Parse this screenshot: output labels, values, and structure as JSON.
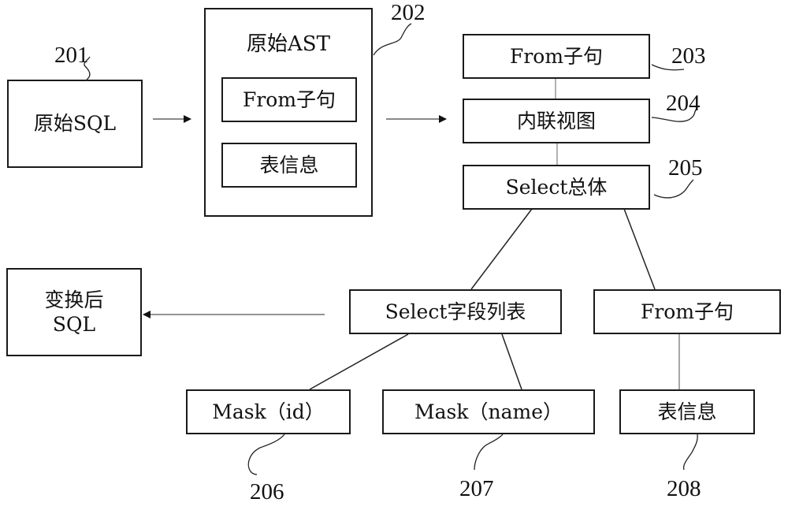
{
  "diagram": {
    "original_sql": {
      "label": "原始SQL",
      "ref": "201"
    },
    "original_ast": {
      "title": "原始AST",
      "ref": "202",
      "children": [
        {
          "label": "From子句"
        },
        {
          "label": "表信息"
        }
      ]
    },
    "from_clause_top": {
      "label": "From子句",
      "ref": "203"
    },
    "inline_view": {
      "label": "内联视图",
      "ref": "204"
    },
    "select_whole": {
      "label": "Select总体",
      "ref": "205"
    },
    "select_field_list": {
      "label": "Select字段列表"
    },
    "from_clause_bottom": {
      "label": "From子句"
    },
    "mask_id": {
      "label": "Mask（id）",
      "ref": "206"
    },
    "mask_name": {
      "label": "Mask（name）",
      "ref": "207"
    },
    "table_info_bottom": {
      "label": "表信息",
      "ref": "208"
    },
    "transformed_sql": {
      "line1": "变换后",
      "line2": "SQL"
    },
    "edges": [
      {
        "from": "原始SQL",
        "to": "原始AST",
        "type": "arrow"
      },
      {
        "from": "原始AST",
        "to": "From子句 (203)",
        "type": "arrow"
      },
      {
        "from": "From子句 (203)",
        "to": "内联视图",
        "type": "line"
      },
      {
        "from": "内联视图",
        "to": "Select总体",
        "type": "line"
      },
      {
        "from": "Select总体",
        "to": "Select字段列表",
        "type": "line"
      },
      {
        "from": "Select总体",
        "to": "From子句",
        "type": "line"
      },
      {
        "from": "Select字段列表",
        "to": "Mask（id）",
        "type": "line"
      },
      {
        "from": "Select字段列表",
        "to": "Mask（name）",
        "type": "line"
      },
      {
        "from": "From子句",
        "to": "表信息",
        "type": "line"
      },
      {
        "from": "Select字段列表",
        "to": "变换后SQL",
        "type": "arrow"
      }
    ]
  }
}
